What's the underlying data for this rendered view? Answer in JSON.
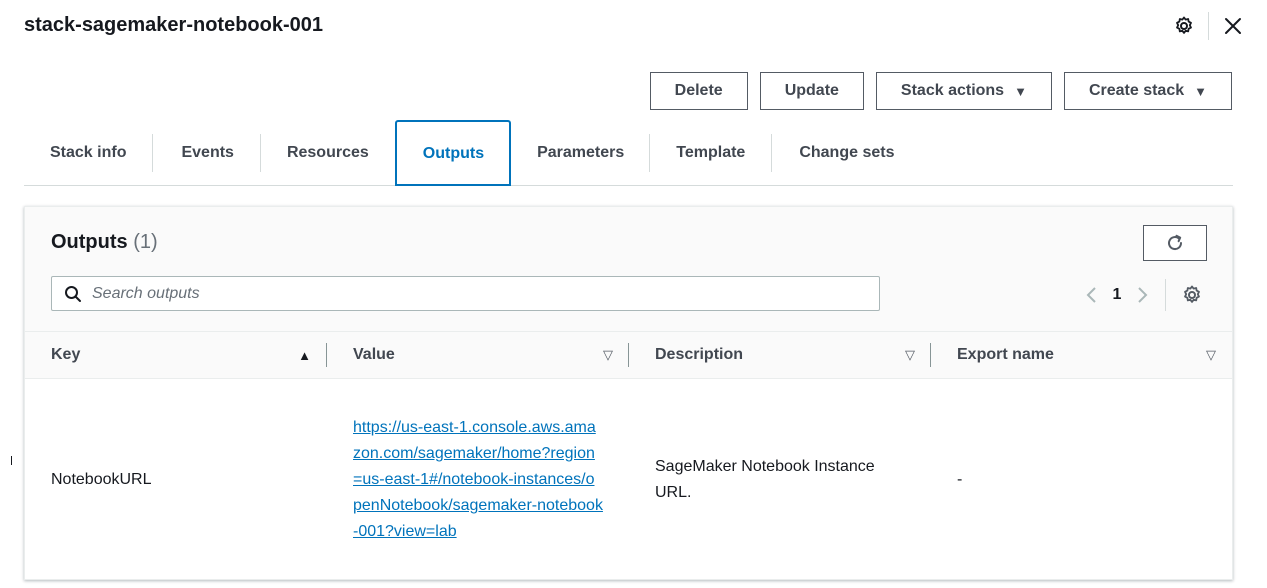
{
  "page": {
    "title": "stack-sagemaker-notebook-001"
  },
  "header_icons": [
    "gear-icon",
    "close-icon"
  ],
  "actions": {
    "delete": "Delete",
    "update": "Update",
    "stack_actions": "Stack actions",
    "create_stack": "Create stack"
  },
  "tabs": [
    {
      "label": "Stack info",
      "active": false
    },
    {
      "label": "Events",
      "active": false
    },
    {
      "label": "Resources",
      "active": false
    },
    {
      "label": "Outputs",
      "active": true
    },
    {
      "label": "Parameters",
      "active": false
    },
    {
      "label": "Template",
      "active": false
    },
    {
      "label": "Change sets",
      "active": false
    }
  ],
  "outputs": {
    "title": "Outputs",
    "count": "(1)",
    "search_placeholder": "Search outputs",
    "page_number": "1",
    "columns": {
      "key": "Key",
      "value": "Value",
      "description": "Description",
      "export_name": "Export name"
    },
    "rows": [
      {
        "key": "NotebookURL",
        "value": "https://us-east-1.console.aws.amazon.com/sagemaker/home?region=us-east-1#/notebook-instances/openNotebook/sagemaker-notebook-001?view=lab",
        "description": "SageMaker Notebook Instance URL.",
        "export_name": "-"
      }
    ]
  },
  "colors": {
    "accent": "#0073bb",
    "text": "#16191f",
    "muted_text": "#687078",
    "border": "#545b64"
  }
}
